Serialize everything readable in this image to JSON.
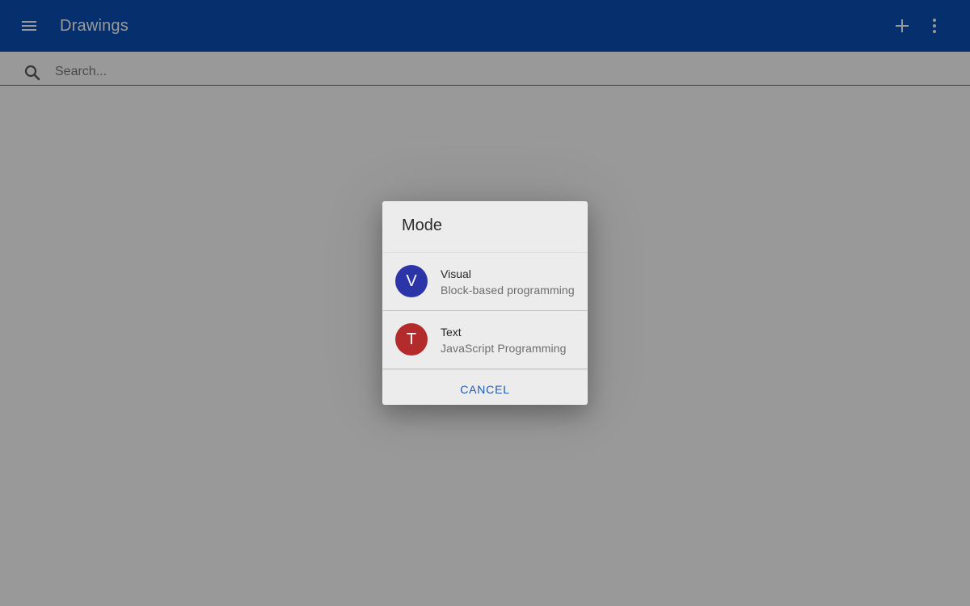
{
  "toolbar": {
    "title": "Drawings",
    "menu_icon": "menu-icon",
    "add_icon": "plus-icon",
    "more_icon": "more-vertical-icon",
    "color": "#0a4fb6"
  },
  "search": {
    "placeholder": "Search...",
    "value": "",
    "icon": "search-icon"
  },
  "dialog": {
    "title": "Mode",
    "options": [
      {
        "avatar_letter": "V",
        "avatar_color": "#2c35a8",
        "label": "Visual",
        "description": "Block-based programming"
      },
      {
        "avatar_letter": "T",
        "avatar_color": "#b42b2b",
        "label": "Text",
        "description": "JavaScript Programming"
      }
    ],
    "cancel_label": "CANCEL",
    "accent_color": "#2059ad"
  }
}
